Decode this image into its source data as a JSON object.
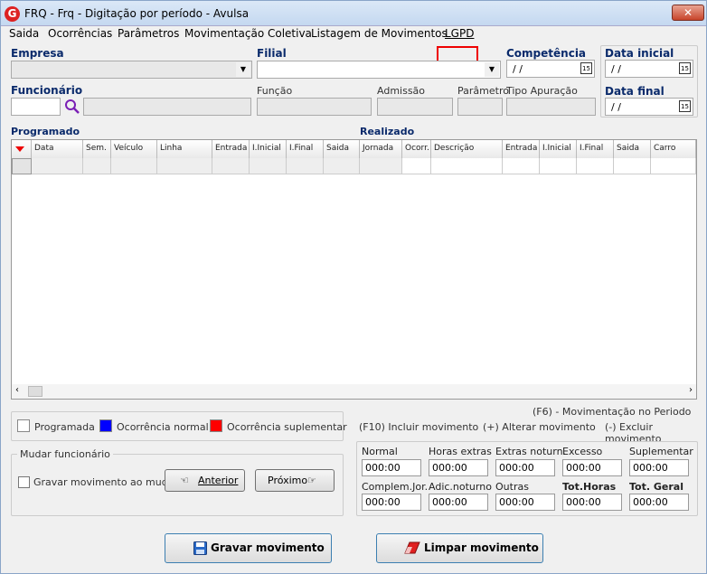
{
  "window": {
    "icon": "G",
    "title": "FRQ - Frq - Digitação por período - Avulsa",
    "close_label": "✕"
  },
  "menu": [
    "Saida",
    "Ocorrências",
    "Parâmetros",
    "Movimentação Coletiva",
    "Listagem de Movimentos",
    "LGPD"
  ],
  "form": {
    "empresa_label": "Empresa",
    "filial_label": "Filial",
    "competencia_label": "Competência",
    "competencia_value": "/ /",
    "data_inicial_label": "Data inicial",
    "data_inicial_value": "/ /",
    "data_final_label": "Data final",
    "data_final_value": "/ /",
    "funcionario_label": "Funcionário",
    "funcao_label": "Função",
    "admissao_label": "Admissão",
    "parametro_label": "Parâmetro",
    "tipo_apuracao_label": "Tipo Apuração",
    "cal_icon": "15"
  },
  "grid": {
    "programado_label": "Programado",
    "realizado_label": "Realizado",
    "columns": [
      "Data",
      "Sem.",
      "Veículo",
      "Linha",
      "Entrada",
      "I.Inicial",
      "I.Final",
      "Saida",
      "Jornada",
      "Ocorr.",
      "Descrição",
      "Entrada",
      "I.Inicial",
      "I.Final",
      "Saida",
      "Carro"
    ]
  },
  "legend": {
    "programada": "Programada",
    "ocorrencia_normal": "Ocorrência normal",
    "ocorrencia_suplementar": "Ocorrência suplementar",
    "colors": {
      "programada": "#ffffff",
      "normal": "#0000ff",
      "suplementar": "#ff0000"
    }
  },
  "shortcuts": {
    "f6": "(F6) - Movimentação no Periodo",
    "f10": "(F10) Incluir movimento",
    "alterar": "(+) Alterar movimento",
    "excluir": "(-) Excluir movimento"
  },
  "mudar": {
    "title": "Mudar funcionário",
    "checkbox": "Gravar movimento ao mudar",
    "anterior": "Anterior",
    "proximo": "Próximo"
  },
  "totals": {
    "labels": [
      "Normal",
      "Horas extras",
      "Extras noturn.",
      "Excesso",
      "Suplementar",
      "Complem.Jor.",
      "Adic.noturno",
      "Outras",
      "Tot.Horas",
      "Tot. Geral"
    ],
    "values": [
      "000:00",
      "000:00",
      "000:00",
      "000:00",
      "000:00",
      "000:00",
      "000:00",
      "000:00",
      "000:00",
      "000:00"
    ]
  },
  "buttons": {
    "gravar": "Gravar movimento",
    "limpar": "Limpar movimento"
  }
}
